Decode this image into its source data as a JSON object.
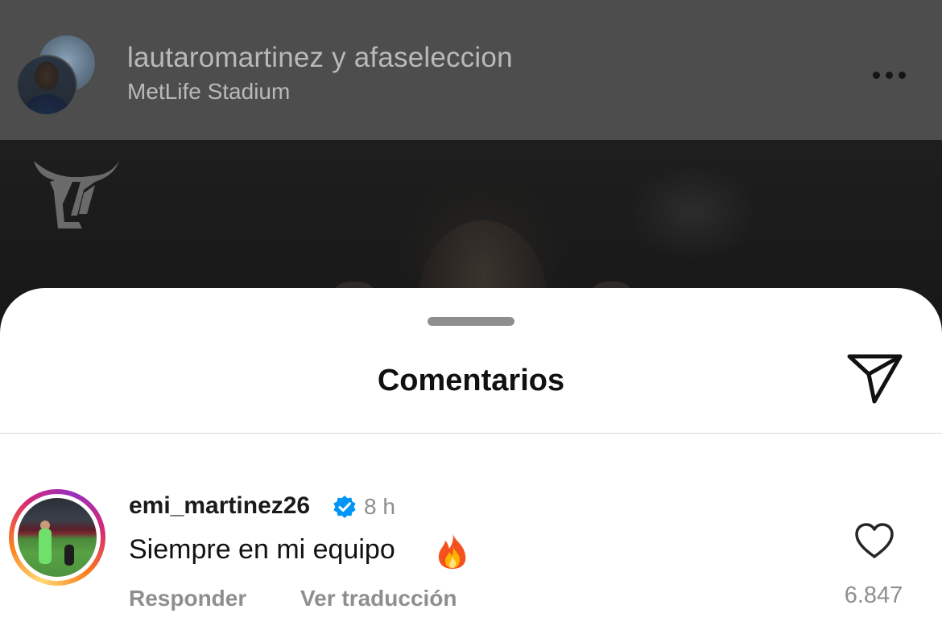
{
  "post": {
    "owner": "lautaromartinez y afaseleccion",
    "location": "MetLife Stadium",
    "more_icon": "ellipsis-icon",
    "background": "#4d4d4d"
  },
  "sheet": {
    "title": "Comentarios",
    "share_icon": "paper-plane-icon"
  },
  "comment": {
    "username": "emi_martinez26",
    "verified_icon": "verified-badge-icon",
    "time": "8 h",
    "text": "Siempre en mi equipo",
    "emoji_icon": "fire-emoji-icon",
    "reply_label": "Responder",
    "translate_label": "Ver traducción",
    "like_icon": "heart-outline-icon",
    "like_count": "6.847",
    "verified_color": "#0095f6"
  }
}
